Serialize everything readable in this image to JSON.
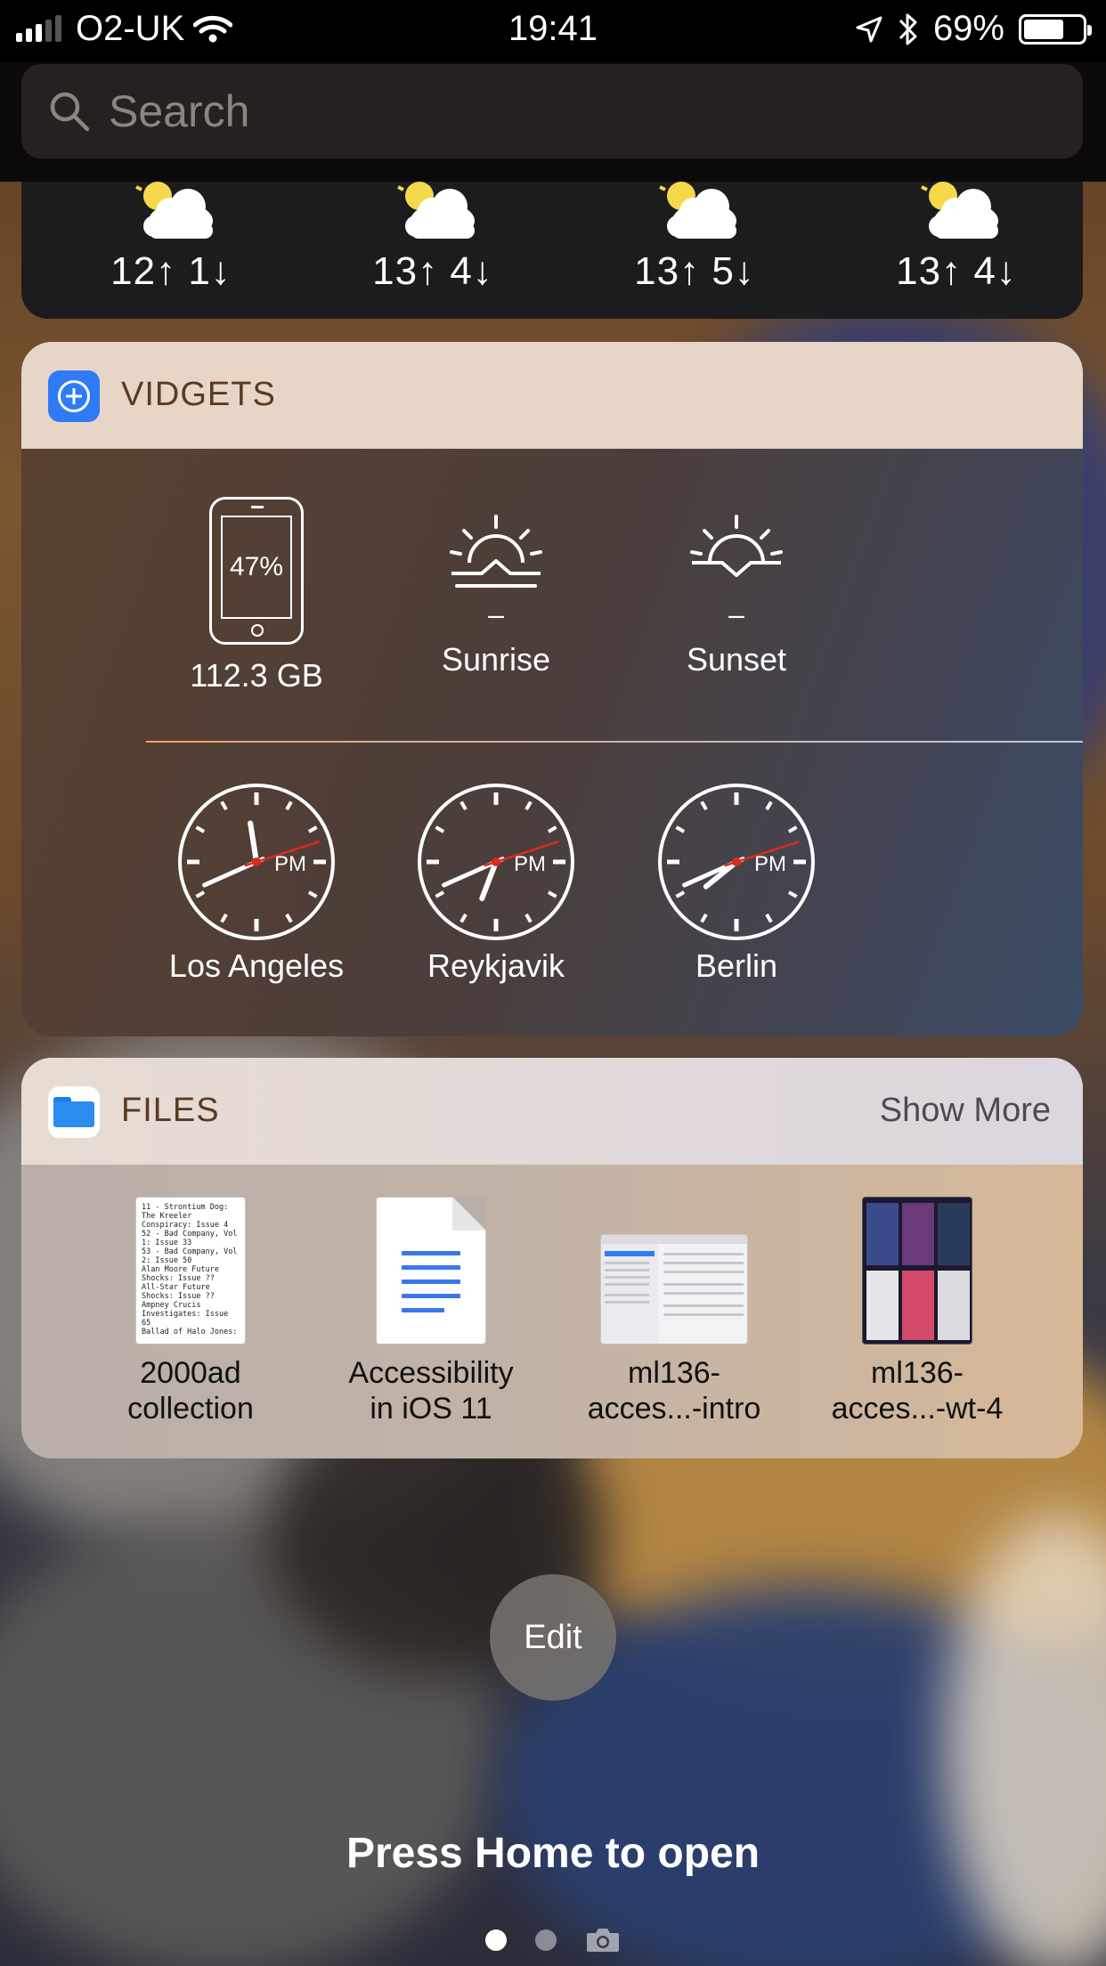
{
  "status_bar": {
    "carrier": "O2-UK",
    "time": "19:41",
    "battery_percent_text": "69%",
    "battery_level": 0.69
  },
  "search": {
    "placeholder": "Search"
  },
  "weather": {
    "days": [
      {
        "high": "12",
        "low": "1",
        "icon": "partly-cloudy-icon"
      },
      {
        "high": "13",
        "low": "4",
        "icon": "partly-cloudy-icon"
      },
      {
        "high": "13",
        "low": "5",
        "icon": "partly-cloudy-icon"
      },
      {
        "high": "13",
        "low": "4",
        "icon": "partly-cloudy-icon"
      }
    ],
    "up_arrow": "↑",
    "down_arrow": "↓"
  },
  "vidgets": {
    "title": "VIDGETS",
    "storage": {
      "percent": "47%",
      "label": "112.3 GB"
    },
    "sunrise": {
      "value": "–",
      "label": "Sunrise"
    },
    "sunset": {
      "value": "–",
      "label": "Sunset"
    },
    "clocks": [
      {
        "city": "Los Angeles",
        "meridiem": "PM",
        "hour": 11.7,
        "minute": 41,
        "second": 12
      },
      {
        "city": "Reykjavik",
        "meridiem": "PM",
        "hour": 6.7,
        "minute": 41,
        "second": 12
      },
      {
        "city": "Berlin",
        "meridiem": "PM",
        "hour": 7.7,
        "minute": 41,
        "second": 12
      }
    ]
  },
  "files": {
    "title": "FILES",
    "show_more": "Show More",
    "items": [
      {
        "name_line1": "2000ad",
        "name_line2": "collection",
        "preview_text": "11 - Strontium Dog: The Kreeler Conspiracy: Issue 4\n52 - Bad Company, Vol 1: Issue 33\n53 - Bad Company, Vol 2: Issue 50\nAlan Moore Future Shocks: Issue ??\nAll-Star Future Shocks: Issue ??\nAmpney Crucis Investigates: Issue 65\nBallad of Halo Jones:"
      },
      {
        "name_line1": "Accessibility",
        "name_line2": "in iOS 11"
      },
      {
        "name_line1": "ml136-",
        "name_line2": "acces...-intro"
      },
      {
        "name_line1": "ml136-",
        "name_line2": "acces...-wt-4"
      }
    ]
  },
  "edit_label": "Edit",
  "lock_hint": "Press Home to open",
  "page_dots": {
    "count": 2,
    "active": 0,
    "camera_icon": "camera-icon"
  },
  "colors": {
    "vidgets_accent": "#2f7bf5",
    "files_accent": "#2d8cf0",
    "clock_second_hand": "#e0281e"
  }
}
